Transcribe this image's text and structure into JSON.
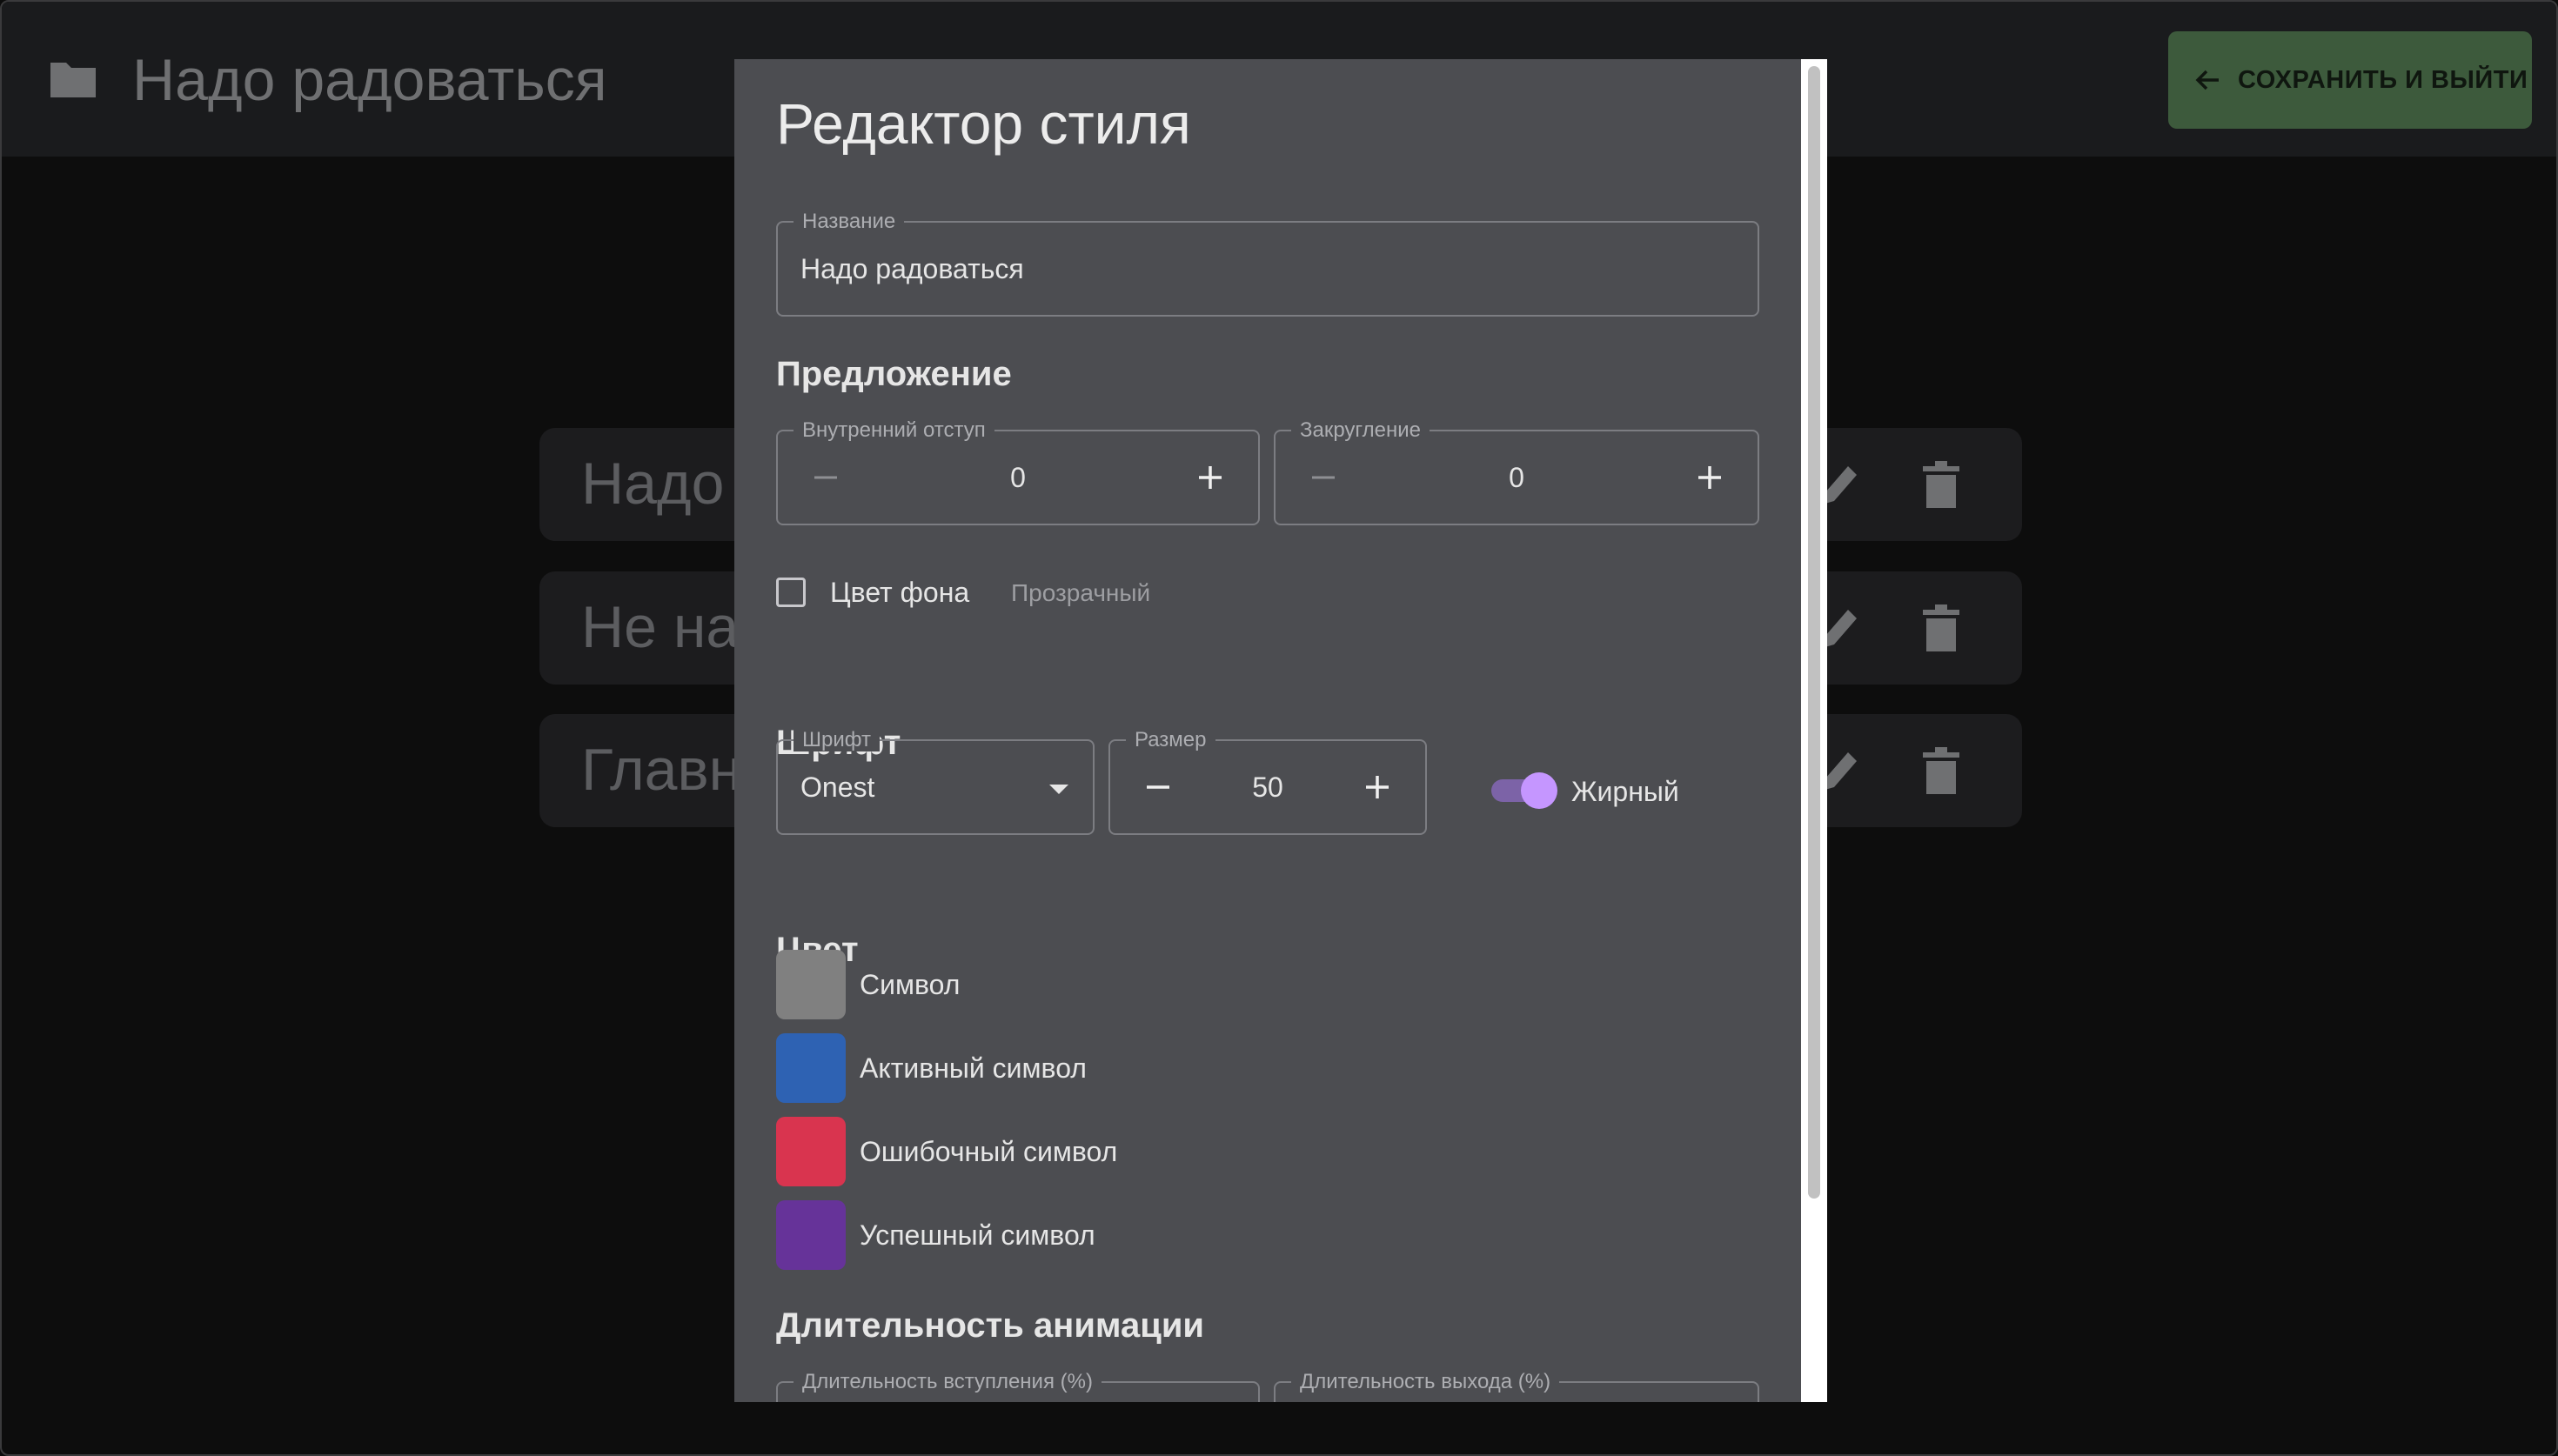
{
  "app_bar": {
    "title": "Надо радоваться",
    "save_button_label": "СОХРАНИТЬ И ВЫЙТИ",
    "save_button_color": "#3d5a3c"
  },
  "background_list": {
    "rows": [
      {
        "text": "Надо"
      },
      {
        "text": "Не на"
      },
      {
        "text": "Главн"
      }
    ]
  },
  "dialog": {
    "title": "Редактор стиля",
    "name_field": {
      "label": "Название",
      "value": "Надо радоваться"
    },
    "sentence_section": {
      "title": "Предложение",
      "padding": {
        "label": "Внутренний отступ",
        "value": "0"
      },
      "rounding": {
        "label": "Закругление",
        "value": "0"
      },
      "background": {
        "label": "Цвет фона",
        "hint": "Прозрачный",
        "checked": false
      }
    },
    "font_section": {
      "title": "Шрифт",
      "font": {
        "label": "Шрифт",
        "value": "Onest"
      },
      "size": {
        "label": "Размер",
        "value": "50"
      },
      "bold": {
        "label": "Жирный",
        "on": true
      }
    },
    "color_section": {
      "title": "Цвет",
      "items": [
        {
          "label": "Символ",
          "color": "#808080"
        },
        {
          "label": "Активный символ",
          "color": "#2e62b3"
        },
        {
          "label": "Ошибочный символ",
          "color": "#d9344f"
        },
        {
          "label": "Успешный символ",
          "color": "#663399"
        }
      ]
    },
    "animation_section": {
      "title": "Длительность анимации",
      "enter": {
        "label": "Длительность вступления (%)"
      },
      "exit": {
        "label": "Длительность выхода (%)"
      }
    }
  }
}
